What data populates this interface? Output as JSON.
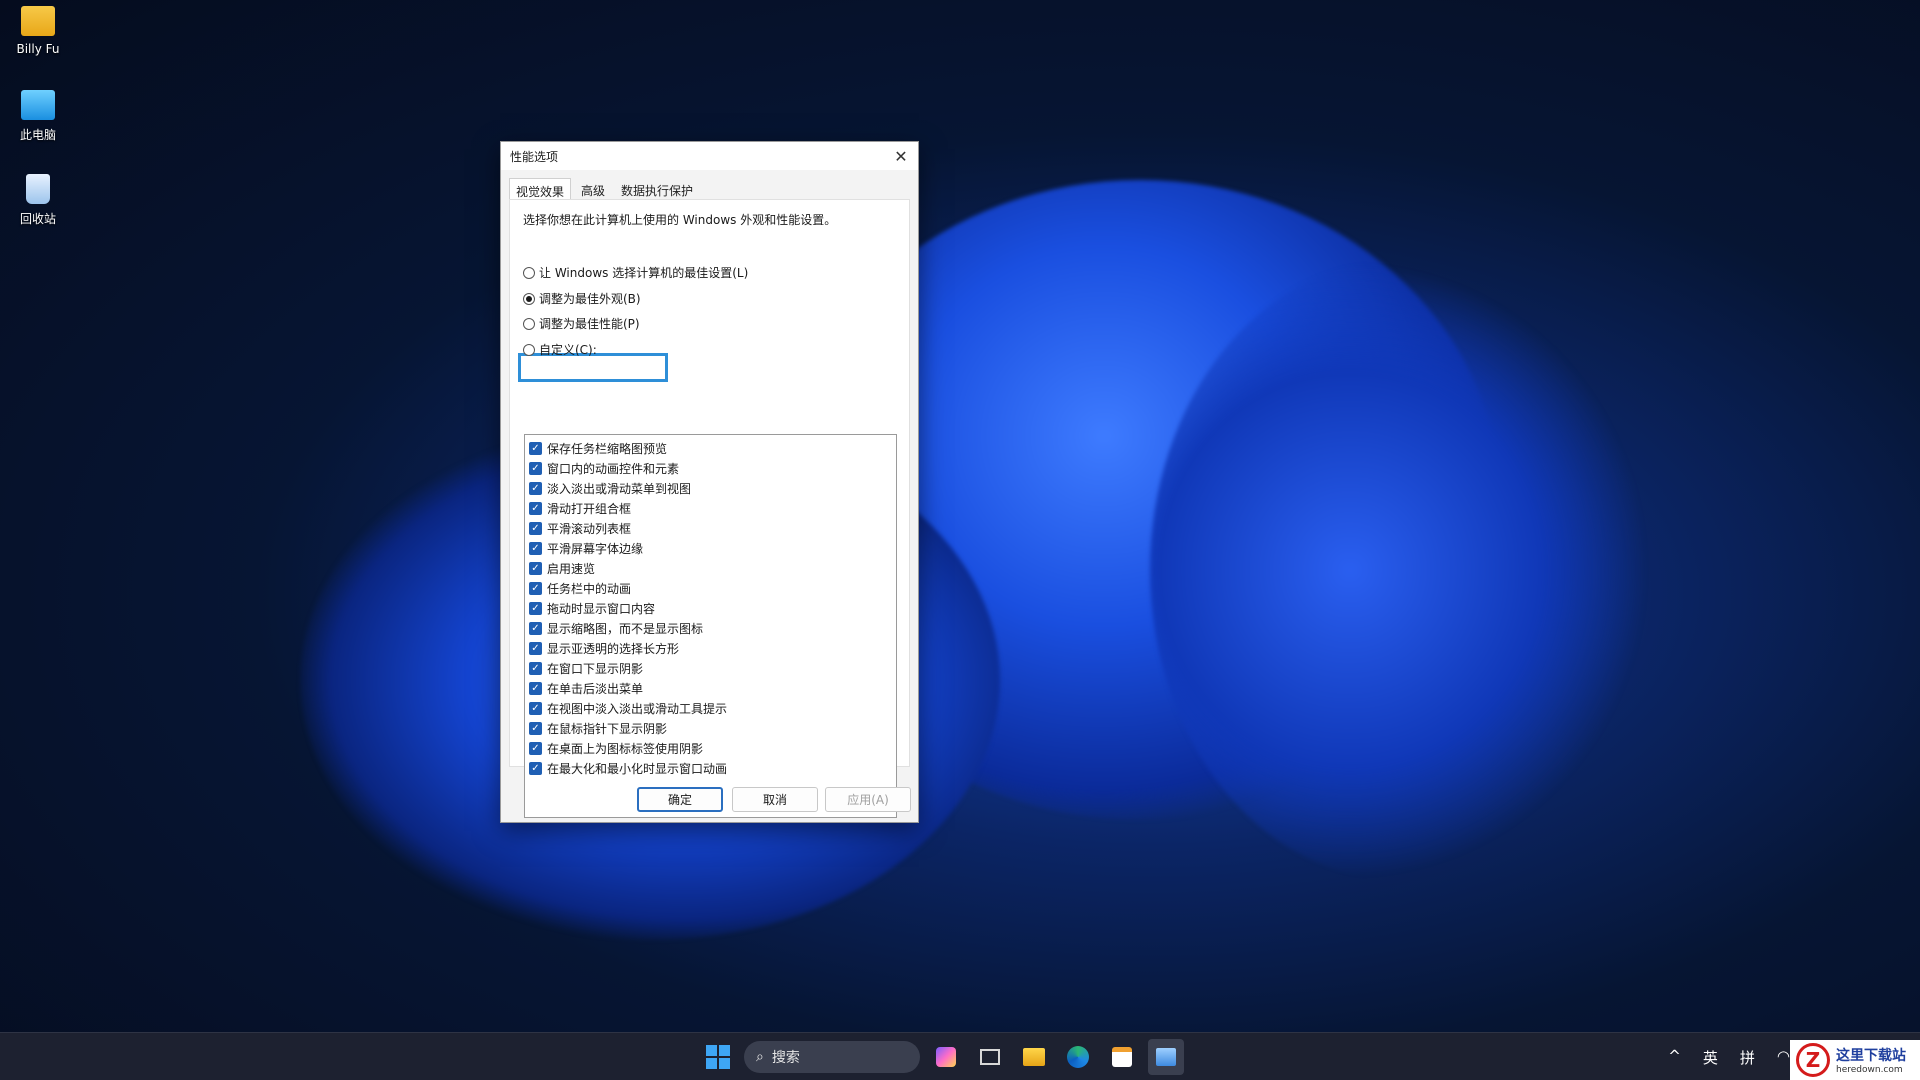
{
  "desktop": {
    "icons": [
      {
        "label": "Billy Fu",
        "icon": "folder-icon"
      },
      {
        "label": "此电脑",
        "icon": "computer-icon"
      },
      {
        "label": "回收站",
        "icon": "recycle-bin-icon"
      }
    ]
  },
  "dialog": {
    "title": "性能选项",
    "tabs": [
      "视觉效果",
      "高级",
      "数据执行保护"
    ],
    "active_tab": "视觉效果",
    "description": "选择你想在此计算机上使用的 Windows 外观和性能设置。",
    "options": [
      {
        "label": "让 Windows 选择计算机的最佳设置(L)",
        "checked": false
      },
      {
        "label": "调整为最佳外观(B)",
        "checked": true
      },
      {
        "label": "调整为最佳性能(P)",
        "checked": false
      },
      {
        "label": "自定义(C):",
        "checked": false
      }
    ],
    "effects": [
      "保存任务栏缩略图预览",
      "窗口内的动画控件和元素",
      "淡入淡出或滑动菜单到视图",
      "滑动打开组合框",
      "平滑滚动列表框",
      "平滑屏幕字体边缘",
      "启用速览",
      "任务栏中的动画",
      "拖动时显示窗口内容",
      "显示缩略图，而不是显示图标",
      "显示亚透明的选择长方形",
      "在窗口下显示阴影",
      "在单击后淡出菜单",
      "在视图中淡入淡出或滑动工具提示",
      "在鼠标指针下显示阴影",
      "在桌面上为图标标签使用阴影",
      "在最大化和最小化时显示窗口动画"
    ],
    "buttons": {
      "ok": "确定",
      "cancel": "取消",
      "apply": "应用(A)"
    },
    "highlight_color": "#2e8fd8"
  },
  "taskbar": {
    "search_placeholder": "搜索",
    "tray": {
      "lang1": "英",
      "lang2": "拼"
    }
  },
  "watermark": {
    "logo": "Z",
    "cn": "这里下载站",
    "en": "heredown.com"
  }
}
